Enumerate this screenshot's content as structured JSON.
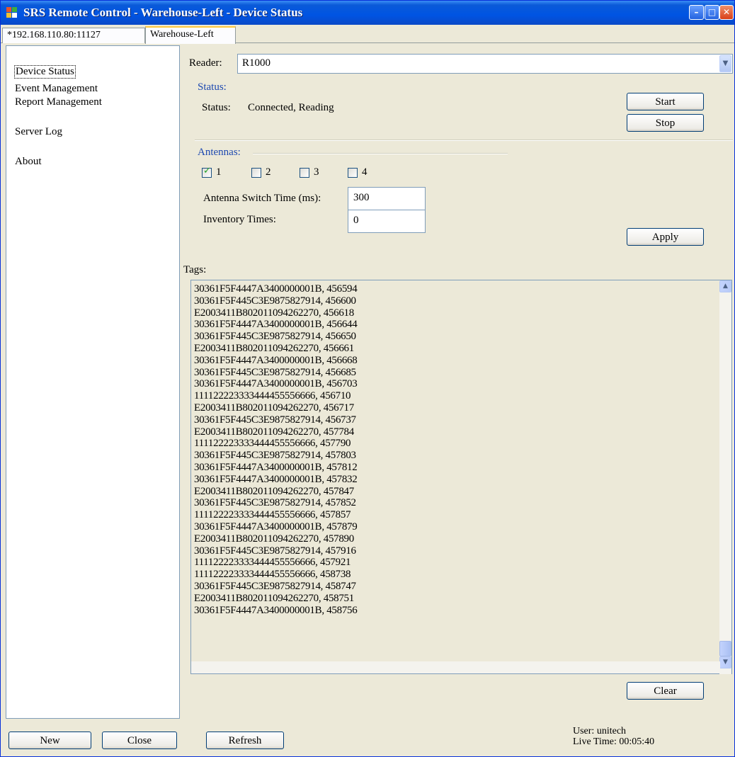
{
  "window": {
    "title": "SRS Remote Control - Warehouse-Left - Device Status",
    "controls": [
      "minimize-icon",
      "maximize-icon",
      "close-icon"
    ]
  },
  "tabs": [
    {
      "label": "*192.168.110.80:11127",
      "active": false
    },
    {
      "label": "Warehouse-Left",
      "active": true
    }
  ],
  "sidebar": {
    "items": [
      {
        "label": "Device Status",
        "selected": true
      },
      {
        "label": "Event Management",
        "selected": false
      },
      {
        "label": "Report Management",
        "selected": false
      },
      {
        "label": "Server Log",
        "selected": false
      },
      {
        "label": "About",
        "selected": false
      }
    ]
  },
  "reader": {
    "label": "Reader:",
    "selected": "R1000"
  },
  "status": {
    "section_label": "Status:",
    "label": "Status:",
    "value": "Connected, Reading",
    "start_label": "Start",
    "stop_label": "Stop"
  },
  "antennas": {
    "section_label": "Antennas:",
    "items": [
      {
        "label": "1",
        "checked": true
      },
      {
        "label": "2",
        "checked": false
      },
      {
        "label": "3",
        "checked": false
      },
      {
        "label": "4",
        "checked": false
      }
    ],
    "switch_time_label": "Antenna Switch Time (ms):",
    "switch_time_value": "300",
    "inventory_label": "Inventory Times:",
    "inventory_value": "0",
    "apply_label": "Apply"
  },
  "tags": {
    "label": "Tags:",
    "rows": [
      "30361F5F4447A3400000001B, 456594",
      "30361F5F445C3E9875827914, 456600",
      "E2003411B802011094262270, 456618",
      "30361F5F4447A3400000001B, 456644",
      "30361F5F445C3E9875827914, 456650",
      "E2003411B802011094262270, 456661",
      "30361F5F4447A3400000001B, 456668",
      "30361F5F445C3E9875827914, 456685",
      "30361F5F4447A3400000001B, 456703",
      "111122223333444455556666, 456710",
      "E2003411B802011094262270, 456717",
      "30361F5F445C3E9875827914, 456737",
      "E2003411B802011094262270, 457784",
      "111122223333444455556666, 457790",
      "30361F5F445C3E9875827914, 457803",
      "30361F5F4447A3400000001B, 457812",
      "30361F5F4447A3400000001B, 457832",
      "E2003411B802011094262270, 457847",
      "30361F5F445C3E9875827914, 457852",
      "111122223333444455556666, 457857",
      "30361F5F4447A3400000001B, 457879",
      "E2003411B802011094262270, 457890",
      "30361F5F445C3E9875827914, 457916",
      "111122223333444455556666, 457921",
      "111122223333444455556666, 458738",
      "30361F5F445C3E9875827914, 458747",
      "E2003411B802011094262270, 458751",
      "30361F5F4447A3400000001B, 458756"
    ],
    "clear_label": "Clear"
  },
  "footer": {
    "new_label": "New",
    "close_label": "Close",
    "refresh_label": "Refresh",
    "user_text": "User: unitech",
    "live_time_text": "Live Time: 00:05:40"
  }
}
